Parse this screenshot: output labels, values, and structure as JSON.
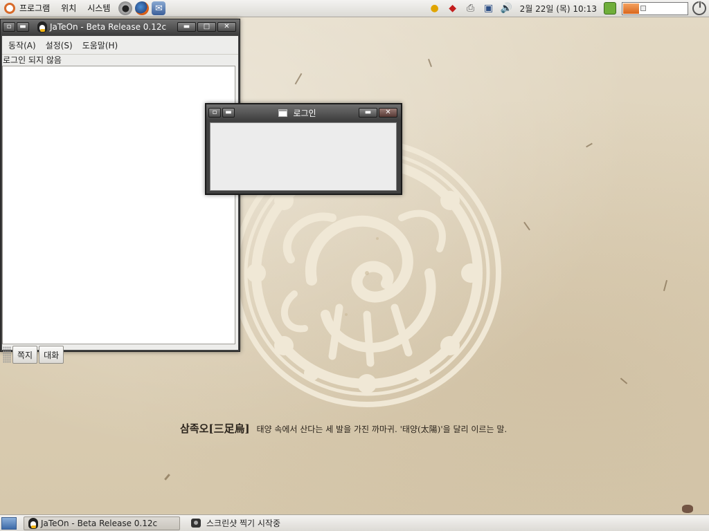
{
  "top_panel": {
    "menus": [
      "프로그램",
      "위치",
      "시스템"
    ],
    "launchers": [
      "web-browser-icon",
      "firefox-icon",
      "mail-icon"
    ],
    "tray_icons": [
      "messenger-icon",
      "gem-icon",
      "printer-icon",
      "network-icon",
      "volume-icon"
    ],
    "clock": "2월 22일 (목) 10:13",
    "battery_level": 0.25
  },
  "main_window": {
    "title": "JaTeOn - Beta Release 0.12c",
    "menubar": [
      "동작(A)",
      "설정(S)",
      "도움말(H)"
    ],
    "status": "로그인 되지 않음",
    "buttons": {
      "note": "쪽지",
      "chat": "대화"
    }
  },
  "login_window": {
    "title": "로그인"
  },
  "wallpaper": {
    "caption_title": "삼족오[三足烏]",
    "caption_text": "태양 속에서 산다는 세 발을 가진 까마귀. '태양(太陽)'을 달리 이르는 말."
  },
  "taskbar": {
    "tasks": [
      {
        "label": "JaTeOn - Beta Release 0.12c",
        "active": true
      },
      {
        "label": "스크린샷 찍기 시작중",
        "active": false
      }
    ]
  },
  "colors": {
    "window_frame": "#404040",
    "wallpaper": "#ddd2bb",
    "emblem": "#efe6d2",
    "battery_fill": "#d8661c"
  }
}
